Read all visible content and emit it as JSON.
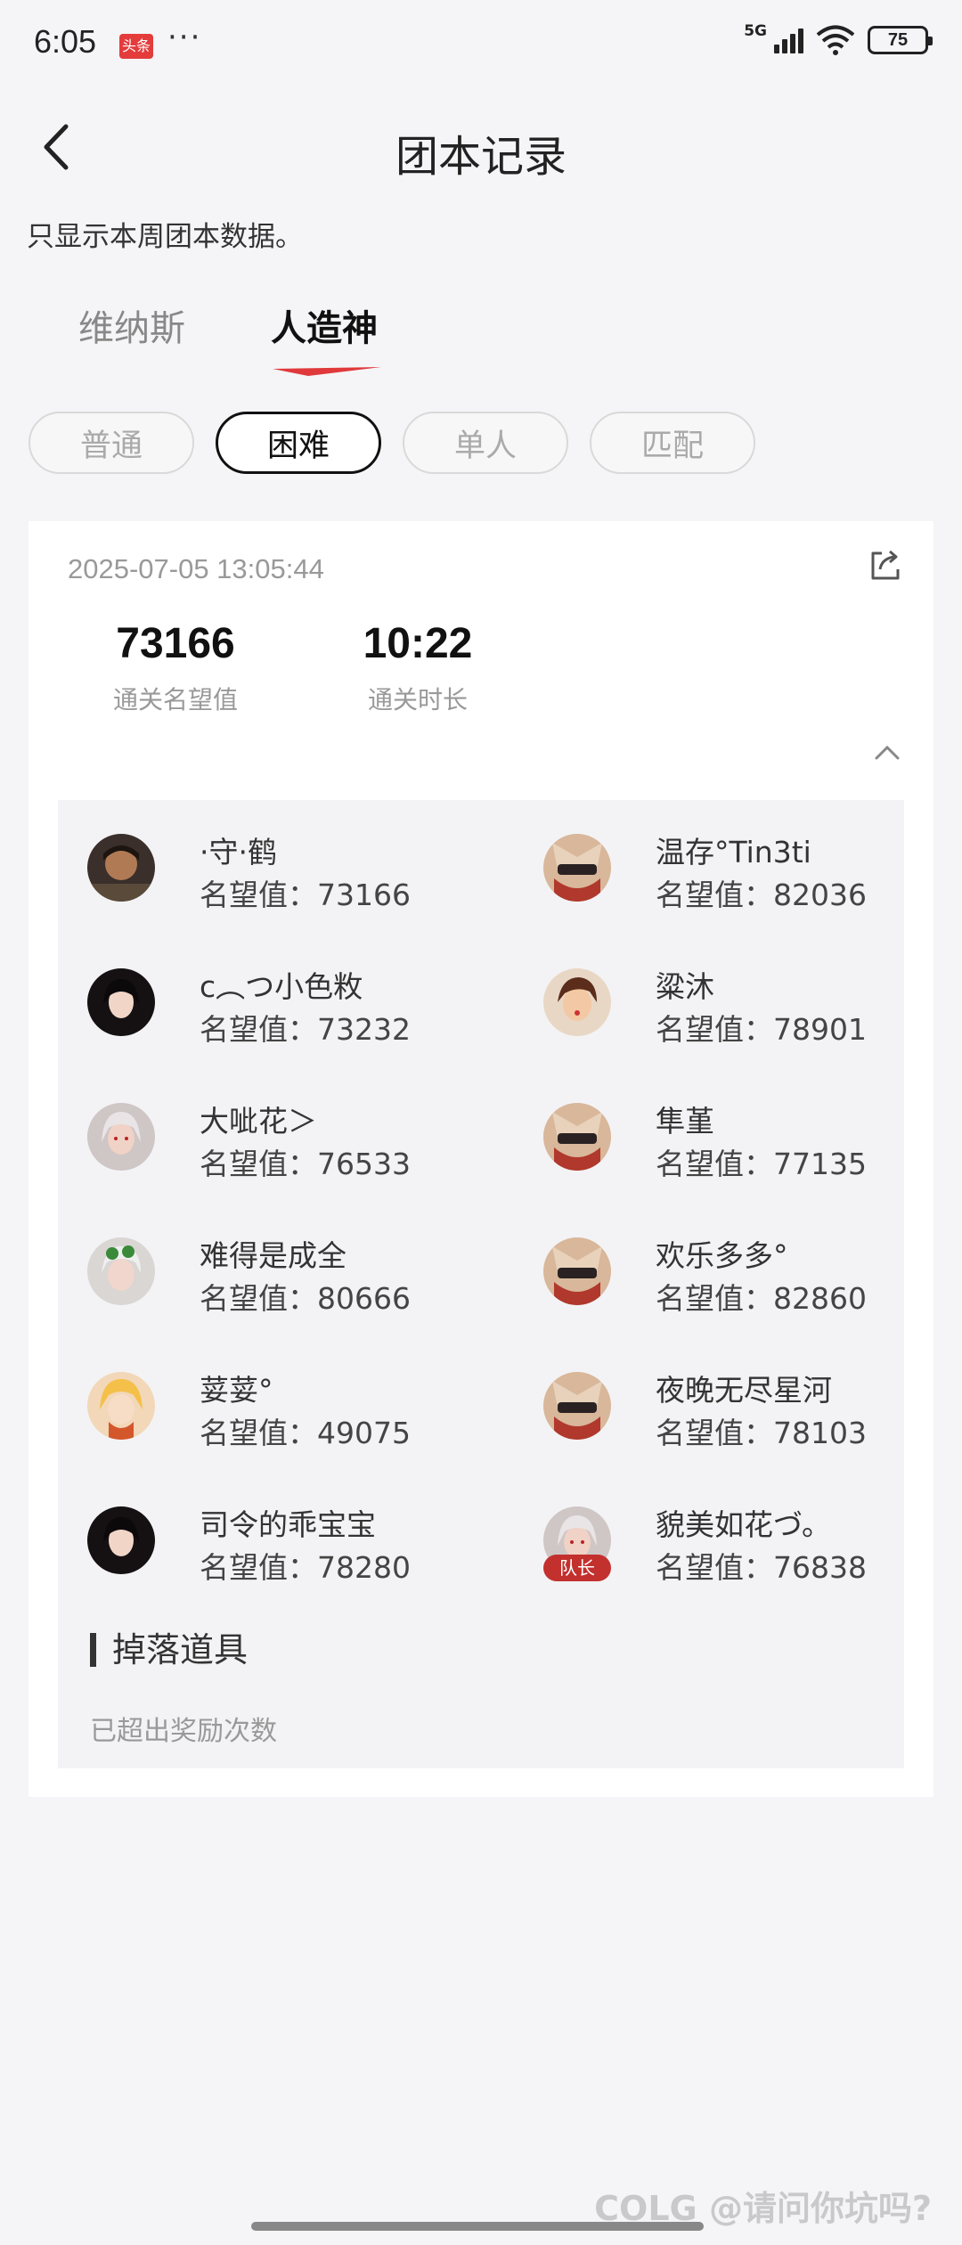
{
  "status_bar": {
    "time": "6:05",
    "app_badge": "头条",
    "dots": "···",
    "network": "5G",
    "battery": "75"
  },
  "header": {
    "title": "团本记录"
  },
  "notice": "只显示本周团本数据。",
  "top_tabs": [
    {
      "label": "维纳斯",
      "active": false
    },
    {
      "label": "人造神",
      "active": true
    }
  ],
  "difficulty_tabs": [
    {
      "label": "普通",
      "active": false
    },
    {
      "label": "困难",
      "active": true
    },
    {
      "label": "单人",
      "active": false
    },
    {
      "label": "匹配",
      "active": false
    }
  ],
  "record": {
    "time": "2025-07-05 13:05:44",
    "stats": [
      {
        "value": "73166",
        "label": "通关名望值"
      },
      {
        "value": "10:22",
        "label": "通关时长"
      }
    ],
    "members": [
      {
        "name": "·守·鹤",
        "reputation": "名望值：73166",
        "avatar": "male-fighter-avatar"
      },
      {
        "name": "温存°Tin3ti",
        "reputation": "名望值：82036",
        "avatar": "masked-warrior-avatar"
      },
      {
        "name": "c︵つ小色敉",
        "reputation": "名望值：73232",
        "avatar": "dark-hair-female-avatar"
      },
      {
        "name": "粱沐",
        "reputation": "名望值：78901",
        "avatar": "female-fighter-avatar"
      },
      {
        "name": "大呲花＞",
        "reputation": "名望值：76533",
        "avatar": "white-hair-female-avatar"
      },
      {
        "name": "隼堇",
        "reputation": "名望值：77135",
        "avatar": "masked-warrior-avatar"
      },
      {
        "name": "难得是成全",
        "reputation": "名望值：80666",
        "avatar": "goggles-gunner-avatar"
      },
      {
        "name": "欢乐多多°",
        "reputation": "名望值：82860",
        "avatar": "masked-warrior-avatar"
      },
      {
        "name": "荽荽°",
        "reputation": "名望值：49075",
        "avatar": "blonde-mage-avatar"
      },
      {
        "name": "夜晚无尽星河",
        "reputation": "名望值：78103",
        "avatar": "masked-warrior-avatar"
      },
      {
        "name": "司令的乖宝宝",
        "reputation": "名望值：78280",
        "avatar": "dark-hair-female-avatar"
      },
      {
        "name": "貌美如花づ。",
        "reputation": "名望值：76838",
        "avatar": "white-hair-female-avatar",
        "badge": "队长"
      }
    ],
    "drops": {
      "title": "掉落道具",
      "note": "已超出奖励次数"
    }
  },
  "watermark": "COLG @请问你坑吗?",
  "colors": {
    "accent_red": "#e0393b",
    "page_bg": "#f5f5f7",
    "members_bg": "#f3f3f5",
    "leader_badge": "#c2312e"
  }
}
